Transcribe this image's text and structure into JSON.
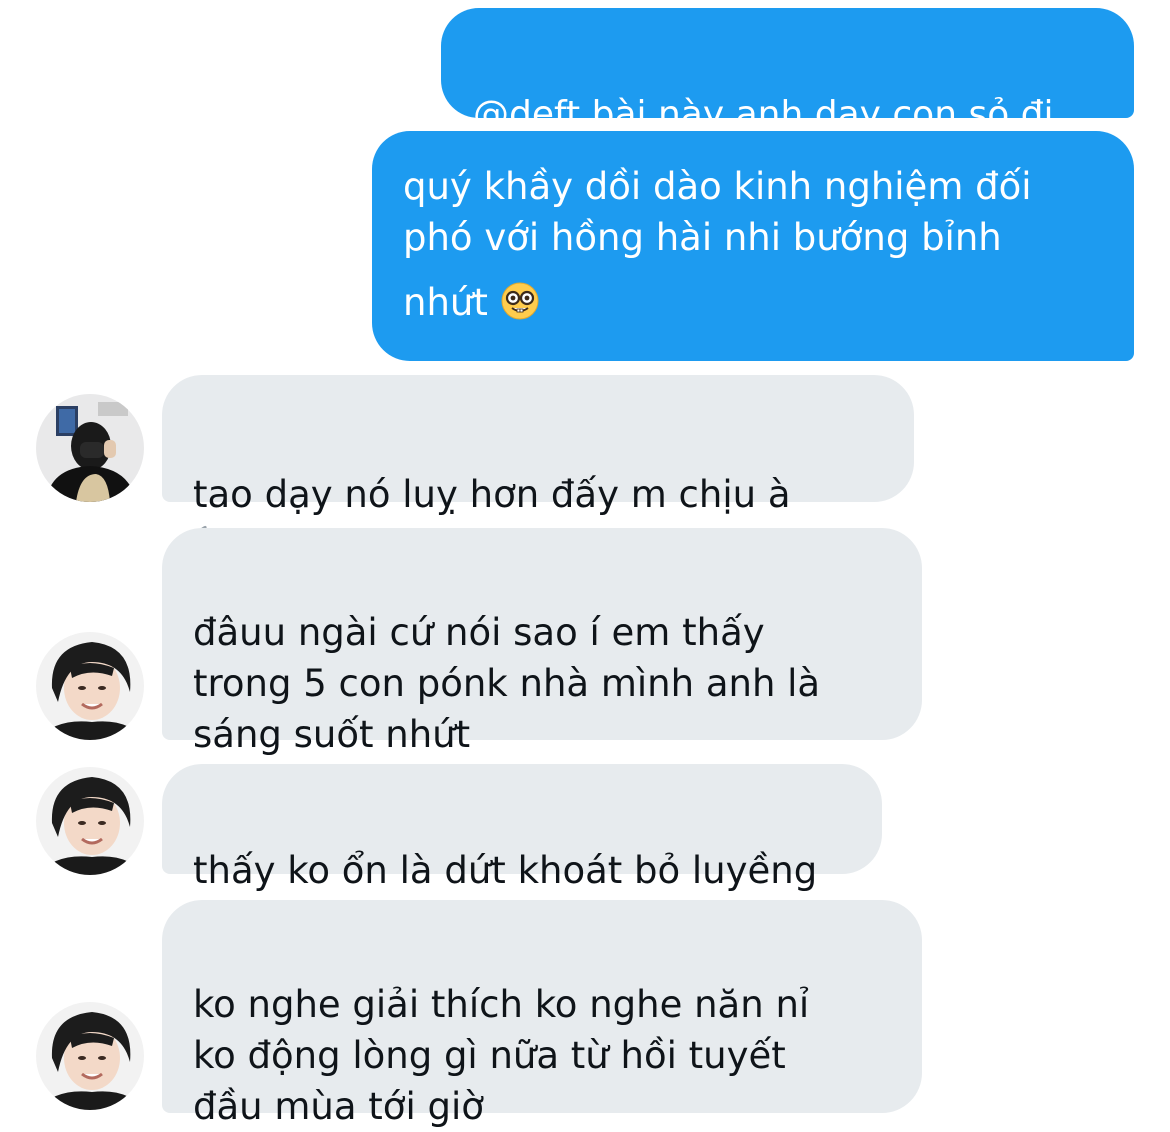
{
  "messages": {
    "m1": {
      "text": "@deft bài này anh dạy con sỏ đi"
    },
    "m2": {
      "line1": "quý khầy dồi dào kinh nghiệm đối",
      "line2": "phó với hồng hài nhi bướng bỉnh",
      "line3": "nhứt",
      "emoji": "nerd-face-emoji"
    },
    "m3": {
      "text": "tao dạy nó luỵ hơn đấy m chịu à",
      "emoji": "cigarette-emoji"
    },
    "m4": {
      "text": "đâuu ngài cứ nói sao í em thấy\ntrong 5 con pónk nhà mình anh là\nsáng suốt nhứt"
    },
    "m5": {
      "text": "thấy ko ổn là dứt khoát bỏ luyềng"
    },
    "m6": {
      "text": "ko nghe giải thích ko nghe năn nỉ\nko động lòng gì nữa từ hồi tuyết\nđầu mùa tới giờ"
    }
  },
  "colors": {
    "sent_bubble": "#1d9bf0",
    "received_bubble": "#e7ebee",
    "received_text": "#0f1419"
  }
}
